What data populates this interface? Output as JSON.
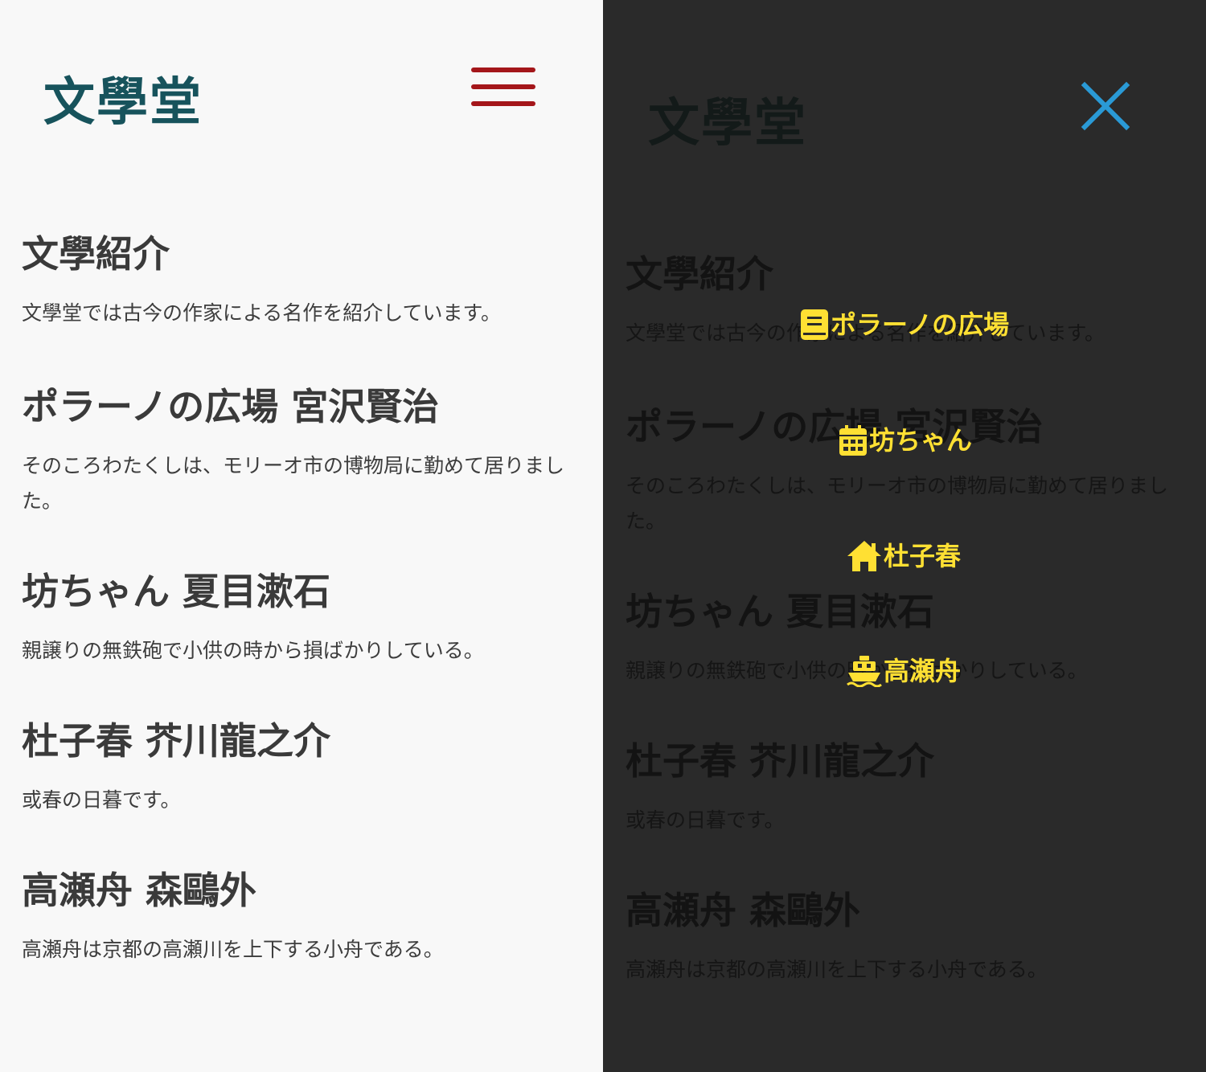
{
  "site": {
    "logo": "文學堂"
  },
  "sections": [
    {
      "title": "文學紹介",
      "text": "文學堂では古今の作家による名作を紹介しています。"
    },
    {
      "title": "ポラーノの広場 宮沢賢治",
      "text": "そのころわたくしは、モリーオ市の博物局に勤めて居りました。"
    },
    {
      "title": "坊ちゃん 夏目漱石",
      "text": "親譲りの無鉄砲で小供の時から損ばかりしている。"
    },
    {
      "title": "杜子春 芥川龍之介",
      "text": "或春の日暮です。"
    },
    {
      "title": "高瀬舟 森鷗外",
      "text": "高瀬舟は京都の高瀬川を上下する小舟である。"
    }
  ],
  "menu": {
    "items": [
      {
        "label": "ポラーノの広場",
        "icon": "book-icon"
      },
      {
        "label": "坊ちゃん",
        "icon": "calendar-icon"
      },
      {
        "label": "杜子春",
        "icon": "home-icon"
      },
      {
        "label": "高瀬舟",
        "icon": "ship-icon"
      }
    ]
  },
  "colors": {
    "logo": "#17535c",
    "hamburger": "#a4161a",
    "close": "#2a9ad6",
    "menu_text": "#ffe033",
    "overlay_bg": "#2a2a2a",
    "page_bg": "#f8f8f8"
  }
}
